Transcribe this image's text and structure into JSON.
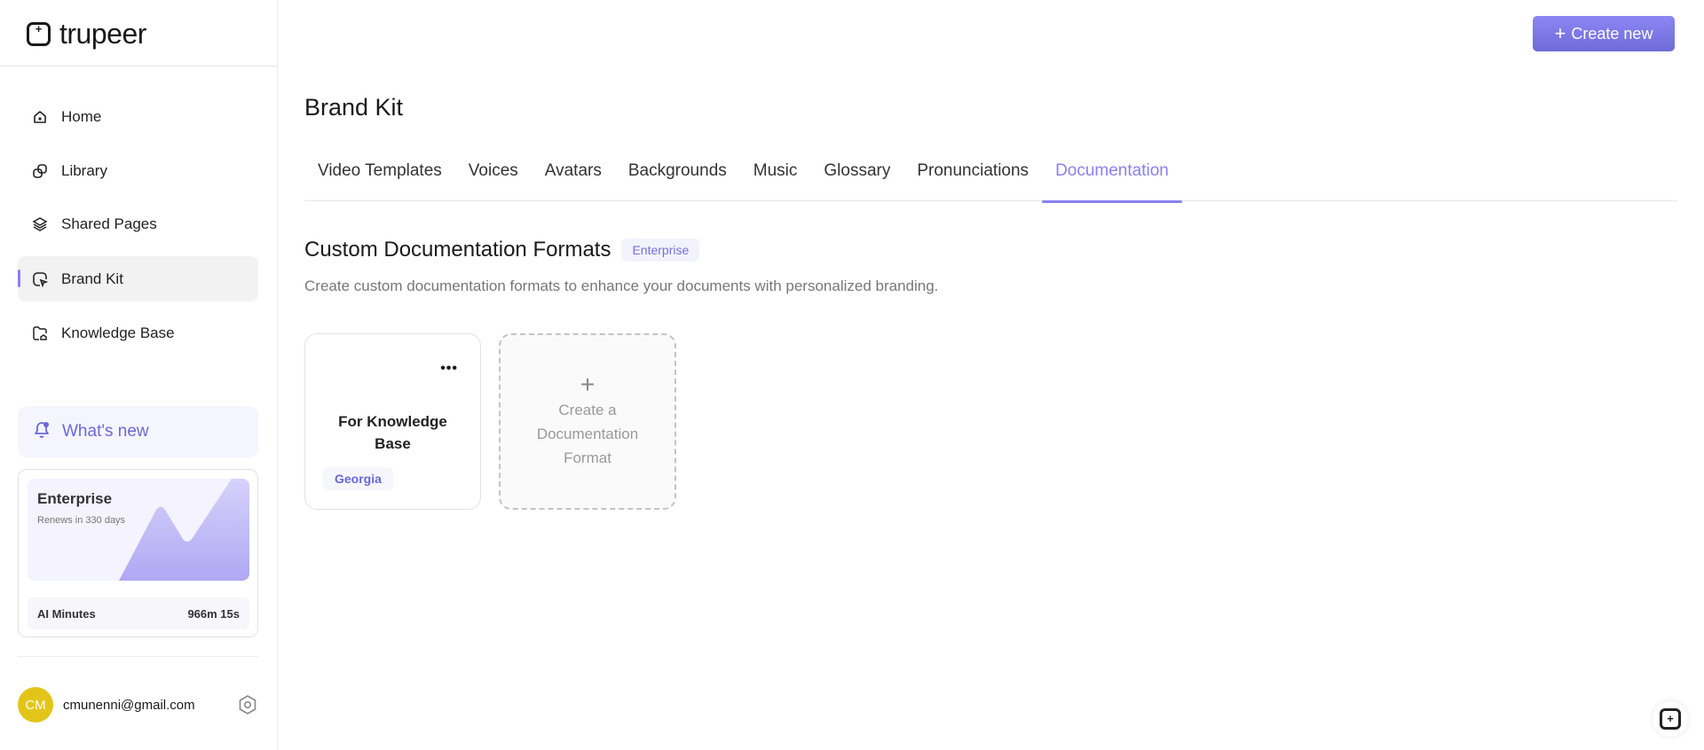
{
  "brand": {
    "name": "trupeer"
  },
  "sidebar": {
    "items": [
      {
        "label": "Home",
        "icon": "home-icon"
      },
      {
        "label": "Library",
        "icon": "library-icon"
      },
      {
        "label": "Shared Pages",
        "icon": "layers-icon"
      },
      {
        "label": "Brand Kit",
        "icon": "brand-kit-icon",
        "active": true
      },
      {
        "label": "Knowledge Base",
        "icon": "folder-icon"
      }
    ],
    "whats_new": "What's new",
    "plan": {
      "name": "Enterprise",
      "renews": "Renews in 330 days",
      "minutes_label": "AI Minutes",
      "minutes_value": "966m 15s"
    },
    "user": {
      "initials": "CM",
      "email": "cmunenni@gmail.com"
    }
  },
  "header": {
    "create_label": "Create new"
  },
  "main": {
    "title": "Brand Kit",
    "tabs": [
      "Video Templates",
      "Voices",
      "Avatars",
      "Backgrounds",
      "Music",
      "Glossary",
      "Pronunciations",
      "Documentation"
    ],
    "active_tab": "Documentation",
    "section": {
      "title": "Custom Documentation Formats",
      "badge": "Enterprise",
      "description": "Create custom documentation formats to enhance your documents with personalized branding."
    },
    "cards": [
      {
        "title": "For Knowledge Base",
        "font": "Georgia"
      }
    ],
    "add_card": {
      "line1": "Create a",
      "line2": "Documentation",
      "line3": "Format"
    }
  },
  "colors": {
    "accent": "#8a80f0",
    "avatar": "#e3c51a"
  }
}
